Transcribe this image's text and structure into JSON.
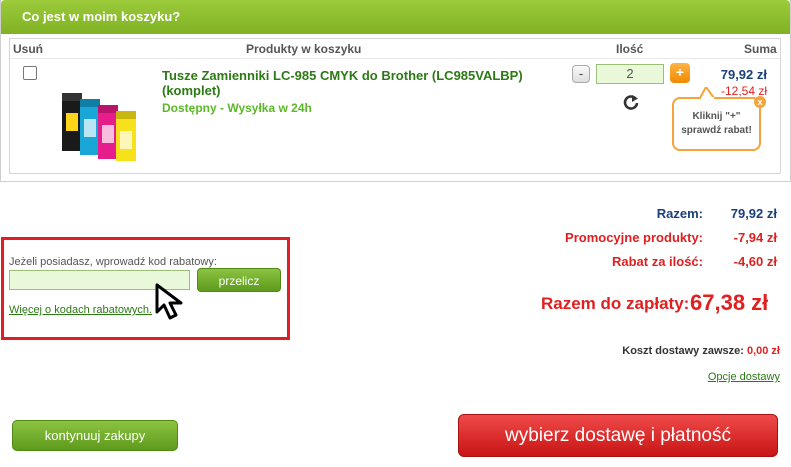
{
  "cart": {
    "title": "Co jest w moim koszyku?",
    "columns": {
      "remove": "Usuń",
      "products": "Produkty w koszyku",
      "qty": "Ilość",
      "sum": "Suma"
    },
    "item": {
      "name": "Tusze Zamienniki LC-985 CMYK do Brother (LC985VALBP) (komplet)",
      "status": "Dostępny - Wysyłka w 24h",
      "quantity": "2",
      "minus": "-",
      "plus": "+",
      "price": "79,92 zł",
      "discount": "-12,54 zł"
    },
    "tooltip": {
      "line1": "Kliknij \"+\"",
      "line2": "sprawdź rabat!",
      "close": "x"
    }
  },
  "summary": {
    "subtotal_label": "Razem:",
    "subtotal_value": "79,92 zł",
    "promo_label": "Promocyjne produkty:",
    "promo_value": "-7,94 zł",
    "qty_discount_label": "Rabat za ilość:",
    "qty_discount_value": "-4,60 zł",
    "total_label": "Razem do zapłaty:",
    "total_value": "67,38 zł",
    "shipping_label": "Koszt dostawy zawsze:",
    "shipping_value": "0,00 zł",
    "shipping_options": "Opcje dostawy"
  },
  "promo_code": {
    "label": "Jeżeli posiadasz, wprowadź kod rabatowy:",
    "value": "",
    "button": "przelicz",
    "link": "Więcej o kodach rabatowych."
  },
  "actions": {
    "continue": "kontynuuj zakupy",
    "checkout": "wybierz dostawę i płatność"
  },
  "colors": {
    "brand_green": "#7fb224",
    "price_red": "#e02020",
    "highlight_red": "#e11d26",
    "accent_orange": "#f5a33a"
  }
}
